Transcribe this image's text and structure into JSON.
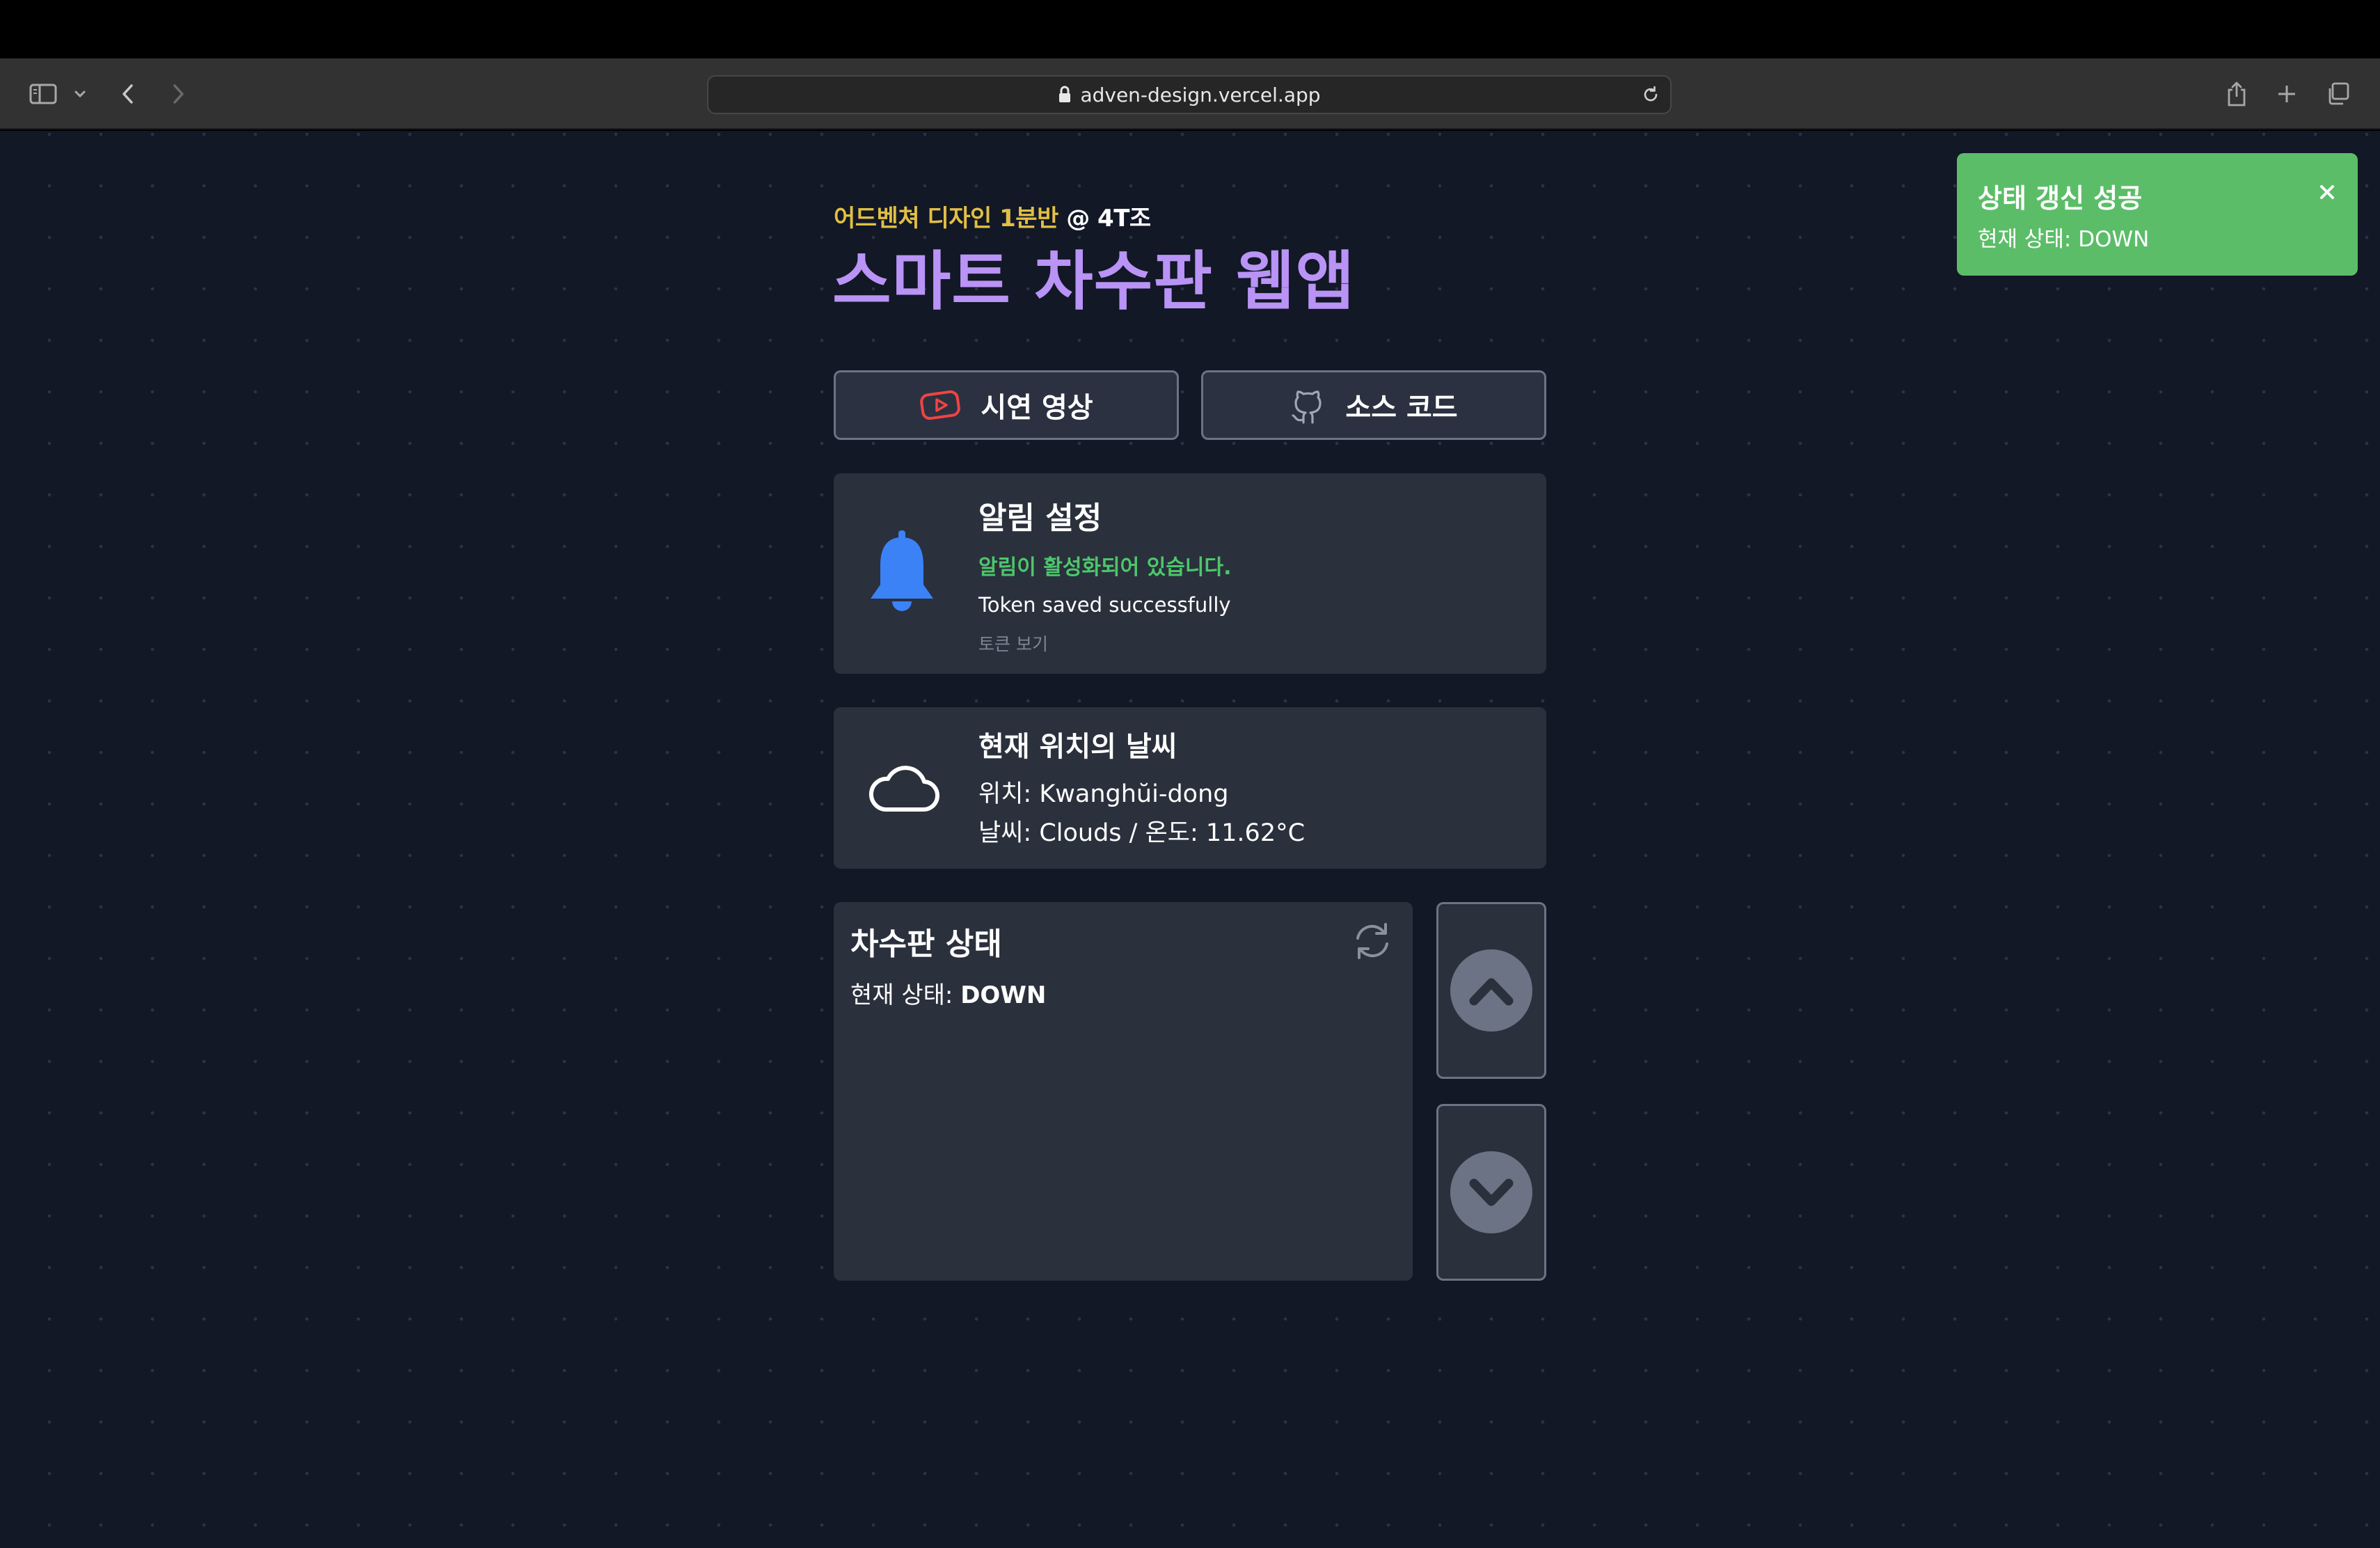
{
  "browser": {
    "url": "adven-design.vercel.app"
  },
  "header": {
    "subtitle": "어드벤쳐 디자인 1분반",
    "subtitle_team": "@ 4T조",
    "title": "스마트 차수판 웹앱"
  },
  "actions": {
    "demo_label": "시연 영상",
    "source_label": "소스 코드"
  },
  "notification": {
    "title": "알림 설정",
    "status": "알림이 활성화되어 있습니다.",
    "message": "Token saved successfully",
    "view_token": "토큰 보기"
  },
  "weather": {
    "title": "현재 위치의 날씨",
    "location_line": "위치: Kwanghŭi-dong",
    "weather_line": "날씨: Clouds / 온도: 11.62°C"
  },
  "floodgate": {
    "title": "차수판 상태",
    "status_prefix": "현재 상태: ",
    "status_value": "DOWN"
  },
  "toast": {
    "title": "상태 갱신 성공",
    "body": "현재 상태: DOWN"
  },
  "icons": {
    "demo": "youtube-icon",
    "source": "github-icon",
    "notification": "bell-icon",
    "weather": "cloud-icon",
    "refresh": "refresh-icon",
    "up": "chevron-up-icon",
    "down": "chevron-down-icon",
    "close": "close-icon"
  },
  "colors": {
    "background": "#121826",
    "card": "#2a303c",
    "title": "#b993f5",
    "subtitle": "#e2bf45",
    "success": "#4dc76b",
    "toast": "#5cbd68",
    "bell": "#3b82f6",
    "youtube": "#ef4444"
  }
}
